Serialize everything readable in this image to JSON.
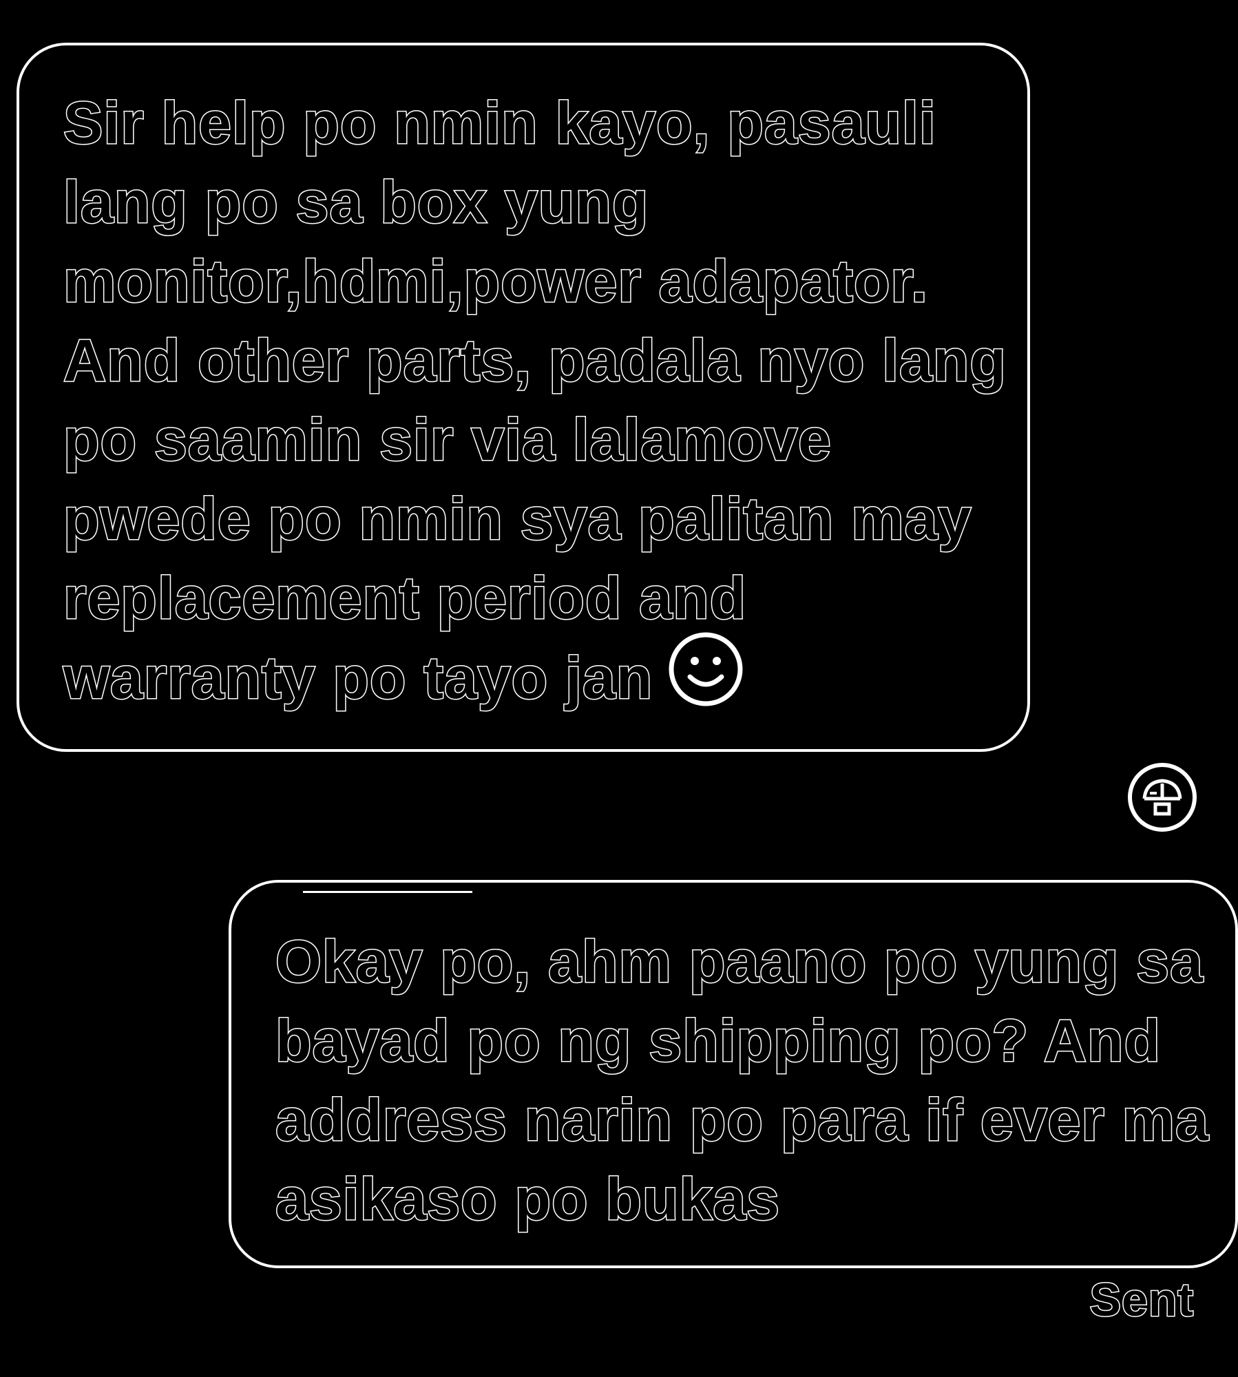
{
  "colors": {
    "background": "#000000",
    "outline": "#ffffff"
  },
  "conversation": {
    "incoming_message": {
      "lines": [
        "Sir help po nmin kayo, pasauli",
        "lang po sa box yung",
        "monitor,hdmi,power adapator.",
        "And other parts, padala nyo lang",
        "po saamin sir via lalamove",
        "pwede po nmin sya palitan may",
        "replacement period and",
        "warranty po tayo jan"
      ],
      "emoji_icon": "smiling-face-icon"
    },
    "avatar_icon": "profile-avatar-icon",
    "outgoing_message": {
      "lines": [
        "Okay po, ahm paano po yung sa",
        "bayad po ng shipping po? And",
        "address narin po para if ever ma",
        "asikaso po bukas"
      ]
    },
    "delivery_status": "Sent"
  }
}
